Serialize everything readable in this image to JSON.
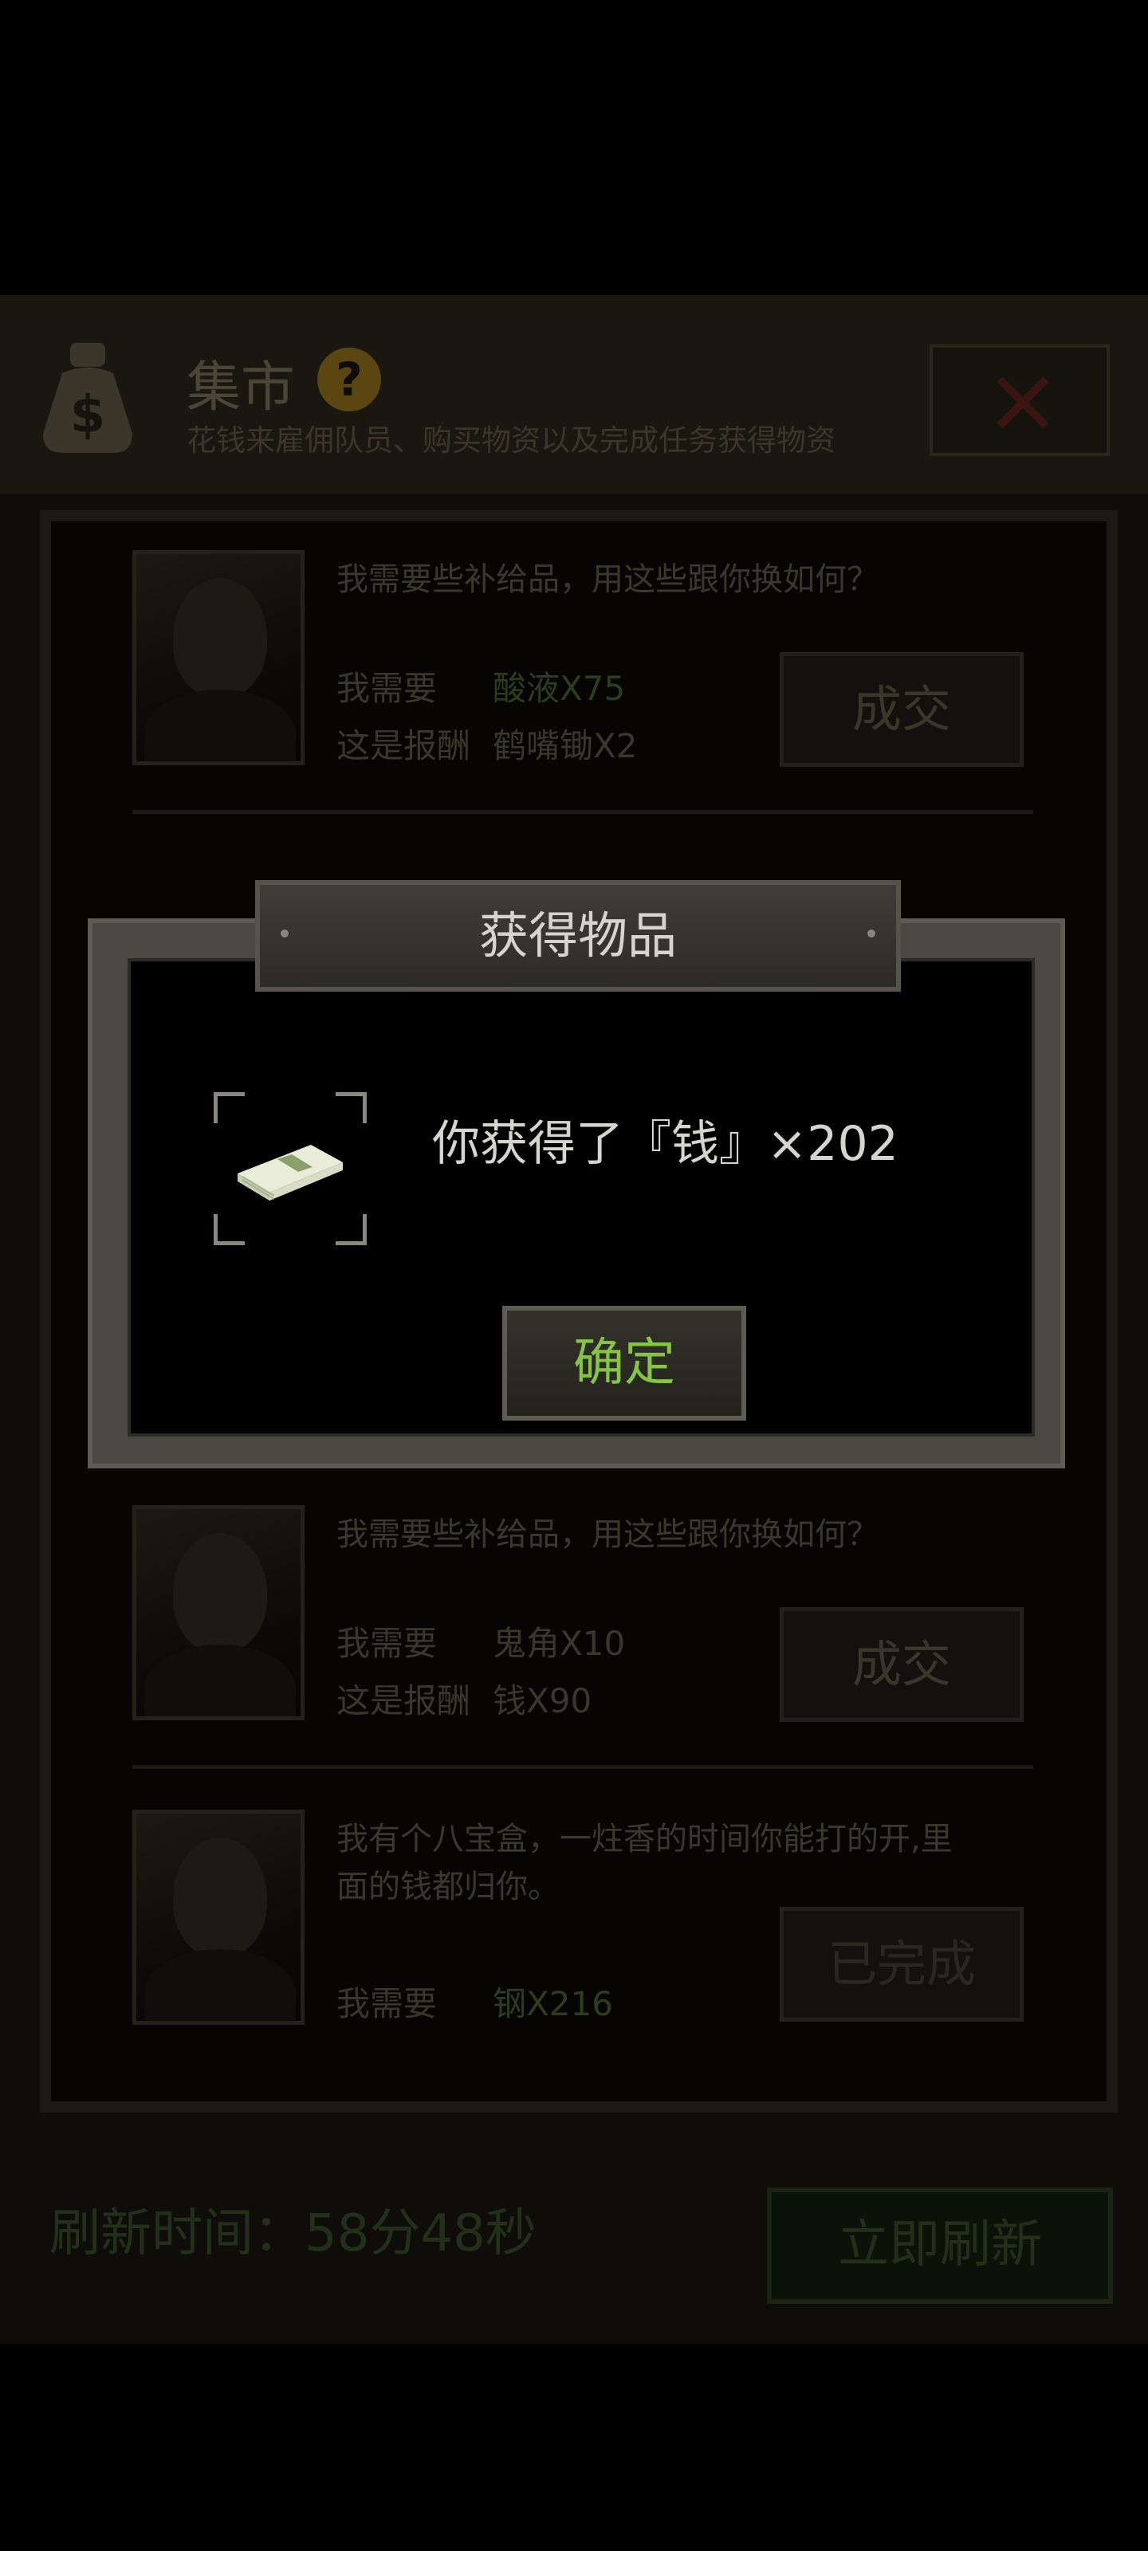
{
  "market": {
    "title": "集市",
    "subtitle": "花钱来雇佣队员、购买物资以及完成任务获得物资",
    "trades": [
      {
        "dialog": "我需要些补给品，用这些跟你换如何？",
        "need_label": "我需要",
        "need_item": "酸液X75",
        "reward_label": "这是报酬",
        "reward_item": "鹤嘴锄X2",
        "button": "成交"
      },
      {
        "dialog": "我有个八宝盒，一炷香的时间你能打的开,里",
        "dialog_line2": "面的钱都归你。",
        "need_label": "我需要",
        "need_item": "钢X216",
        "button": "已完成"
      },
      {
        "dialog": "我需要些补给品，用这些跟你换如何？",
        "need_label": "我需要",
        "need_item": "鬼角X10",
        "reward_label": "这是报酬",
        "reward_item": "钱X90",
        "button": "成交"
      }
    ],
    "refresh_label": "刷新时间：",
    "refresh_time": "58分48秒",
    "refresh_button": "立即刷新"
  },
  "modal": {
    "title": "获得物品",
    "message": "你获得了『钱』×202",
    "confirm": "确定"
  },
  "colors": {
    "accent_green": "#86c544",
    "modal_text": "#d6d4cc"
  },
  "icons": [
    "money-bag-icon",
    "help-icon",
    "close-icon",
    "cash-stack-icon"
  ]
}
